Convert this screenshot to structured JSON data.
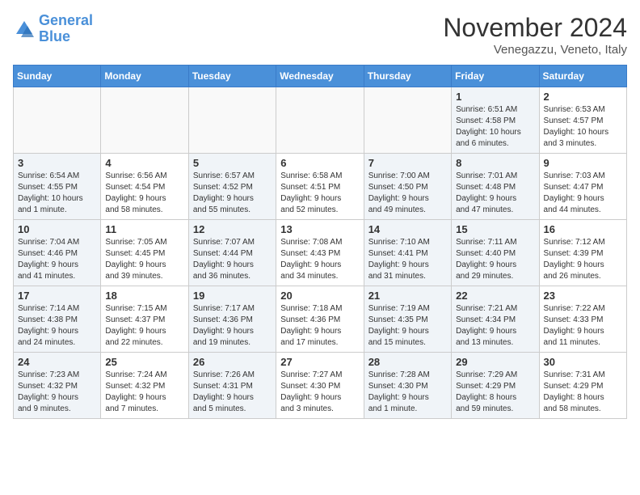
{
  "header": {
    "logo_line1": "General",
    "logo_line2": "Blue",
    "month": "November 2024",
    "location": "Venegazzu, Veneto, Italy"
  },
  "days_of_week": [
    "Sunday",
    "Monday",
    "Tuesday",
    "Wednesday",
    "Thursday",
    "Friday",
    "Saturday"
  ],
  "weeks": [
    [
      {
        "day": "",
        "info": "",
        "shaded": false,
        "empty": true
      },
      {
        "day": "",
        "info": "",
        "shaded": false,
        "empty": true
      },
      {
        "day": "",
        "info": "",
        "shaded": false,
        "empty": true
      },
      {
        "day": "",
        "info": "",
        "shaded": false,
        "empty": true
      },
      {
        "day": "",
        "info": "",
        "shaded": false,
        "empty": true
      },
      {
        "day": "1",
        "info": "Sunrise: 6:51 AM\nSunset: 4:58 PM\nDaylight: 10 hours\nand 6 minutes.",
        "shaded": true,
        "empty": false
      },
      {
        "day": "2",
        "info": "Sunrise: 6:53 AM\nSunset: 4:57 PM\nDaylight: 10 hours\nand 3 minutes.",
        "shaded": false,
        "empty": false
      }
    ],
    [
      {
        "day": "3",
        "info": "Sunrise: 6:54 AM\nSunset: 4:55 PM\nDaylight: 10 hours\nand 1 minute.",
        "shaded": true,
        "empty": false
      },
      {
        "day": "4",
        "info": "Sunrise: 6:56 AM\nSunset: 4:54 PM\nDaylight: 9 hours\nand 58 minutes.",
        "shaded": false,
        "empty": false
      },
      {
        "day": "5",
        "info": "Sunrise: 6:57 AM\nSunset: 4:52 PM\nDaylight: 9 hours\nand 55 minutes.",
        "shaded": true,
        "empty": false
      },
      {
        "day": "6",
        "info": "Sunrise: 6:58 AM\nSunset: 4:51 PM\nDaylight: 9 hours\nand 52 minutes.",
        "shaded": false,
        "empty": false
      },
      {
        "day": "7",
        "info": "Sunrise: 7:00 AM\nSunset: 4:50 PM\nDaylight: 9 hours\nand 49 minutes.",
        "shaded": true,
        "empty": false
      },
      {
        "day": "8",
        "info": "Sunrise: 7:01 AM\nSunset: 4:48 PM\nDaylight: 9 hours\nand 47 minutes.",
        "shaded": true,
        "empty": false
      },
      {
        "day": "9",
        "info": "Sunrise: 7:03 AM\nSunset: 4:47 PM\nDaylight: 9 hours\nand 44 minutes.",
        "shaded": false,
        "empty": false
      }
    ],
    [
      {
        "day": "10",
        "info": "Sunrise: 7:04 AM\nSunset: 4:46 PM\nDaylight: 9 hours\nand 41 minutes.",
        "shaded": true,
        "empty": false
      },
      {
        "day": "11",
        "info": "Sunrise: 7:05 AM\nSunset: 4:45 PM\nDaylight: 9 hours\nand 39 minutes.",
        "shaded": false,
        "empty": false
      },
      {
        "day": "12",
        "info": "Sunrise: 7:07 AM\nSunset: 4:44 PM\nDaylight: 9 hours\nand 36 minutes.",
        "shaded": true,
        "empty": false
      },
      {
        "day": "13",
        "info": "Sunrise: 7:08 AM\nSunset: 4:43 PM\nDaylight: 9 hours\nand 34 minutes.",
        "shaded": false,
        "empty": false
      },
      {
        "day": "14",
        "info": "Sunrise: 7:10 AM\nSunset: 4:41 PM\nDaylight: 9 hours\nand 31 minutes.",
        "shaded": true,
        "empty": false
      },
      {
        "day": "15",
        "info": "Sunrise: 7:11 AM\nSunset: 4:40 PM\nDaylight: 9 hours\nand 29 minutes.",
        "shaded": true,
        "empty": false
      },
      {
        "day": "16",
        "info": "Sunrise: 7:12 AM\nSunset: 4:39 PM\nDaylight: 9 hours\nand 26 minutes.",
        "shaded": false,
        "empty": false
      }
    ],
    [
      {
        "day": "17",
        "info": "Sunrise: 7:14 AM\nSunset: 4:38 PM\nDaylight: 9 hours\nand 24 minutes.",
        "shaded": true,
        "empty": false
      },
      {
        "day": "18",
        "info": "Sunrise: 7:15 AM\nSunset: 4:37 PM\nDaylight: 9 hours\nand 22 minutes.",
        "shaded": false,
        "empty": false
      },
      {
        "day": "19",
        "info": "Sunrise: 7:17 AM\nSunset: 4:36 PM\nDaylight: 9 hours\nand 19 minutes.",
        "shaded": true,
        "empty": false
      },
      {
        "day": "20",
        "info": "Sunrise: 7:18 AM\nSunset: 4:36 PM\nDaylight: 9 hours\nand 17 minutes.",
        "shaded": false,
        "empty": false
      },
      {
        "day": "21",
        "info": "Sunrise: 7:19 AM\nSunset: 4:35 PM\nDaylight: 9 hours\nand 15 minutes.",
        "shaded": true,
        "empty": false
      },
      {
        "day": "22",
        "info": "Sunrise: 7:21 AM\nSunset: 4:34 PM\nDaylight: 9 hours\nand 13 minutes.",
        "shaded": true,
        "empty": false
      },
      {
        "day": "23",
        "info": "Sunrise: 7:22 AM\nSunset: 4:33 PM\nDaylight: 9 hours\nand 11 minutes.",
        "shaded": false,
        "empty": false
      }
    ],
    [
      {
        "day": "24",
        "info": "Sunrise: 7:23 AM\nSunset: 4:32 PM\nDaylight: 9 hours\nand 9 minutes.",
        "shaded": true,
        "empty": false
      },
      {
        "day": "25",
        "info": "Sunrise: 7:24 AM\nSunset: 4:32 PM\nDaylight: 9 hours\nand 7 minutes.",
        "shaded": false,
        "empty": false
      },
      {
        "day": "26",
        "info": "Sunrise: 7:26 AM\nSunset: 4:31 PM\nDaylight: 9 hours\nand 5 minutes.",
        "shaded": true,
        "empty": false
      },
      {
        "day": "27",
        "info": "Sunrise: 7:27 AM\nSunset: 4:30 PM\nDaylight: 9 hours\nand 3 minutes.",
        "shaded": false,
        "empty": false
      },
      {
        "day": "28",
        "info": "Sunrise: 7:28 AM\nSunset: 4:30 PM\nDaylight: 9 hours\nand 1 minute.",
        "shaded": true,
        "empty": false
      },
      {
        "day": "29",
        "info": "Sunrise: 7:29 AM\nSunset: 4:29 PM\nDaylight: 8 hours\nand 59 minutes.",
        "shaded": true,
        "empty": false
      },
      {
        "day": "30",
        "info": "Sunrise: 7:31 AM\nSunset: 4:29 PM\nDaylight: 8 hours\nand 58 minutes.",
        "shaded": false,
        "empty": false
      }
    ]
  ]
}
